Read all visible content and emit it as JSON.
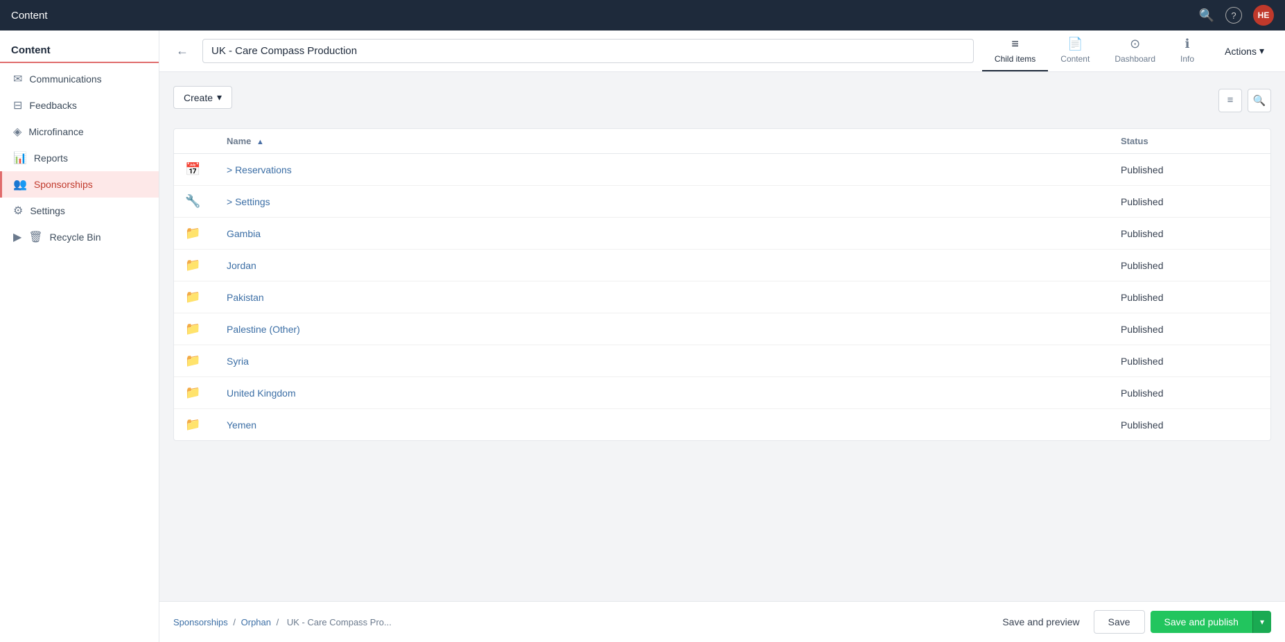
{
  "topnav": {
    "title": "Content",
    "search_icon": "🔍",
    "help_icon": "?",
    "avatar_initials": "HE"
  },
  "sidebar": {
    "header": "Content",
    "items": [
      {
        "id": "communications",
        "label": "Communications",
        "icon": "✉"
      },
      {
        "id": "feedbacks",
        "label": "Feedbacks",
        "icon": "⊟"
      },
      {
        "id": "microfinance",
        "label": "Microfinance",
        "icon": "◈"
      },
      {
        "id": "reports",
        "label": "Reports",
        "icon": "📊",
        "active": false
      },
      {
        "id": "sponsorships",
        "label": "Sponsorships",
        "icon": "👥",
        "active": true
      },
      {
        "id": "settings",
        "label": "Settings",
        "icon": "⚙"
      },
      {
        "id": "recycle-bin",
        "label": "Recycle Bin",
        "icon": "🗑",
        "expandable": true
      }
    ]
  },
  "header": {
    "page_name": "UK - Care Compass Production",
    "back_label": "←",
    "tabs": [
      {
        "id": "child-items",
        "label": "Child items",
        "icon": "≡",
        "active": true
      },
      {
        "id": "content",
        "label": "Content",
        "icon": "📄",
        "active": false
      },
      {
        "id": "dashboard",
        "label": "Dashboard",
        "icon": "⊙",
        "active": false
      },
      {
        "id": "info",
        "label": "Info",
        "icon": "ℹ",
        "active": false
      }
    ],
    "actions_label": "Actions",
    "actions_caret": "▾"
  },
  "table": {
    "create_label": "Create",
    "create_caret": "▾",
    "list_view_icon": "≡",
    "search_icon": "🔍",
    "columns": [
      {
        "id": "icon",
        "label": ""
      },
      {
        "id": "name",
        "label": "Name",
        "sortable": true,
        "sort_icon": "▲"
      },
      {
        "id": "status",
        "label": "Status"
      }
    ],
    "rows": [
      {
        "id": 1,
        "icon": "📅",
        "name": "> Reservations",
        "status": "Published",
        "link": true
      },
      {
        "id": 2,
        "icon": "🔧",
        "name": "> Settings",
        "status": "Published",
        "link": true
      },
      {
        "id": 3,
        "icon": "📁",
        "name": "Gambia",
        "status": "Published",
        "link": true
      },
      {
        "id": 4,
        "icon": "📁",
        "name": "Jordan",
        "status": "Published",
        "link": true
      },
      {
        "id": 5,
        "icon": "📁",
        "name": "Pakistan",
        "status": "Published",
        "link": true
      },
      {
        "id": 6,
        "icon": "📁",
        "name": "Palestine (Other)",
        "status": "Published",
        "link": true
      },
      {
        "id": 7,
        "icon": "📁",
        "name": "Syria",
        "status": "Published",
        "link": true
      },
      {
        "id": 8,
        "icon": "📁",
        "name": "United Kingdom",
        "status": "Published",
        "link": true
      },
      {
        "id": 9,
        "icon": "📁",
        "name": "Yemen",
        "status": "Published",
        "link": true
      }
    ]
  },
  "footer": {
    "breadcrumb": [
      {
        "label": "Sponsorships",
        "link": true
      },
      {
        "label": "Orphan",
        "link": true
      },
      {
        "label": "UK - Care Compass Pro...",
        "link": false
      }
    ],
    "save_preview_label": "Save and preview",
    "save_label": "Save",
    "save_publish_label": "Save and publish"
  },
  "colors": {
    "active_tab_underline": "#1e2a3b",
    "active_sidebar": "#fde8e8",
    "publish_green": "#22c55e",
    "link_blue": "#3b6ea5"
  }
}
